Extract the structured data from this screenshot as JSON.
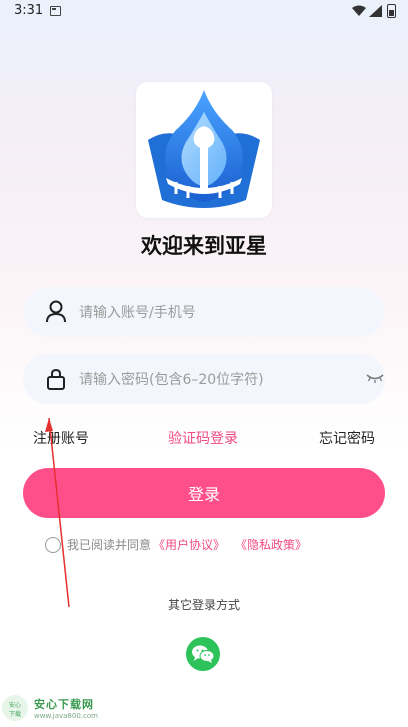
{
  "status": {
    "time": "3:31"
  },
  "app": {
    "title": "欢迎来到亚星"
  },
  "form": {
    "account_placeholder": "请输入账号/手机号",
    "password_placeholder": "请输入密码(包含6–20位字符)"
  },
  "links": {
    "register": "注册账号",
    "sms_login": "验证码登录",
    "forgot": "忘记密码"
  },
  "login_button": "登录",
  "agreement": {
    "prefix": "我已阅读并同意",
    "user_agreement": "《用户协议》",
    "privacy_policy": "《隐私政策》"
  },
  "other_login": "其它登录方式",
  "watermark": {
    "badge_top": "安心",
    "badge_bottom": "下载",
    "name": "安心下载网",
    "url": "www.java800.com"
  },
  "colors": {
    "accent": "#ff4f8b",
    "link_pink": "#f04a86",
    "wechat": "#2dc25a",
    "field_bg": "#f3f6fc",
    "logo_blue": "#1f6fd6"
  }
}
